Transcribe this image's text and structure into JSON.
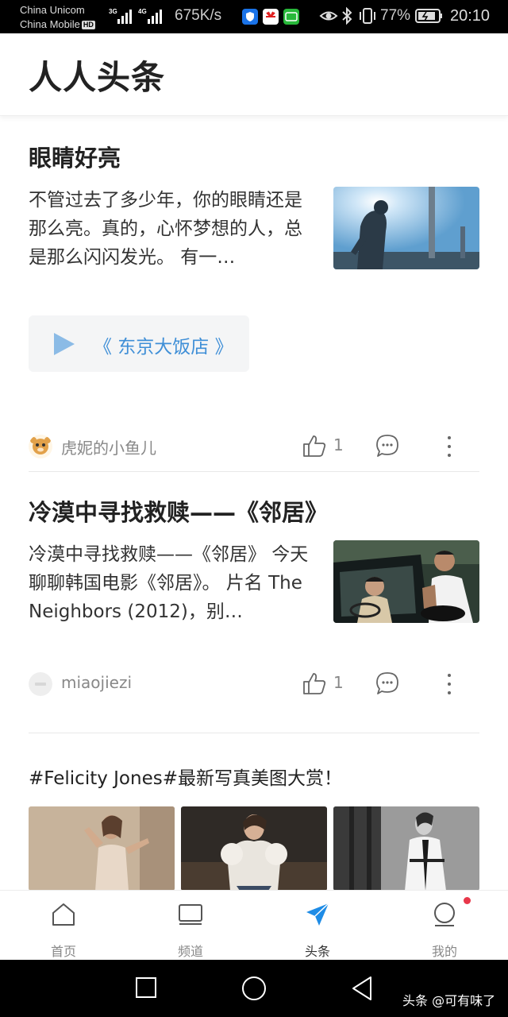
{
  "status_bar": {
    "carrier_1": "China Unicom",
    "carrier_2": "China Mobile",
    "hd": "HD",
    "net_1": "3G",
    "net_2": "4G",
    "speed": "675K/s",
    "battery": "77%",
    "time": "20:10"
  },
  "header": {
    "title": "人人头条"
  },
  "articles": [
    {
      "title": "眼睛好亮",
      "excerpt": "不管过去了多少年，你的眼睛还是那么亮。真的，心怀梦想的人，总是那么闪闪发光。 有一…",
      "video_label": "《 东京大饭店 》",
      "author": "虎妮的小鱼儿",
      "likes": "1"
    },
    {
      "title": "冷漠中寻找救赎——《邻居》",
      "excerpt": "冷漠中寻找救赎——《邻居》 今天聊聊韩国电影《邻居》。 片名 The Neighbors (2012)，别…",
      "author": "miaojiezi",
      "likes": "1"
    }
  ],
  "gallery_post": {
    "title": "#Felicity Jones#最新写真美图大赏！"
  },
  "bottom_nav": {
    "tabs": [
      {
        "label": "首页",
        "icon": "home-icon"
      },
      {
        "label": "频道",
        "icon": "channel-icon"
      },
      {
        "label": "头条",
        "icon": "paper-plane-icon"
      },
      {
        "label": "我的",
        "icon": "profile-icon"
      }
    ],
    "active_index": 2,
    "accent_color": "#1e8ce6"
  },
  "watermark": "头条 @可有味了"
}
